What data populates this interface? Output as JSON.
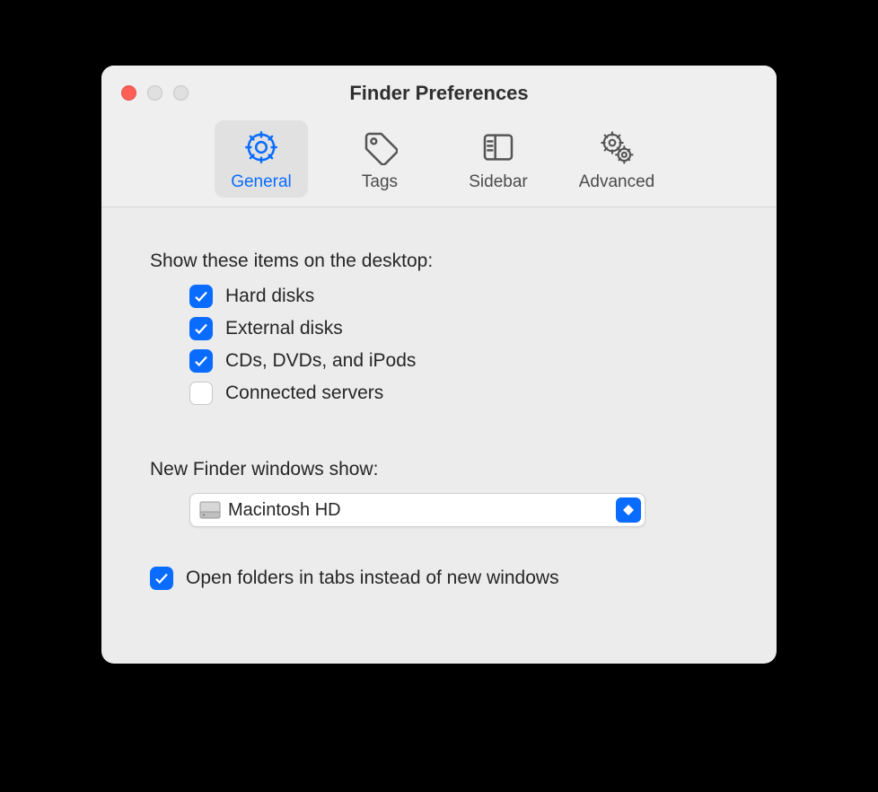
{
  "window": {
    "title": "Finder Preferences"
  },
  "tabs": [
    {
      "label": "General",
      "selected": true
    },
    {
      "label": "Tags",
      "selected": false
    },
    {
      "label": "Sidebar",
      "selected": false
    },
    {
      "label": "Advanced",
      "selected": false
    }
  ],
  "desktop_section_label": "Show these items on the desktop:",
  "desktop_items": [
    {
      "label": "Hard disks",
      "checked": true
    },
    {
      "label": "External disks",
      "checked": true
    },
    {
      "label": "CDs, DVDs, and iPods",
      "checked": true
    },
    {
      "label": "Connected servers",
      "checked": false
    }
  ],
  "new_windows_label": "New Finder windows show:",
  "new_windows_value": "Macintosh HD",
  "open_in_tabs": {
    "label": "Open folders in tabs instead of new windows",
    "checked": true
  }
}
